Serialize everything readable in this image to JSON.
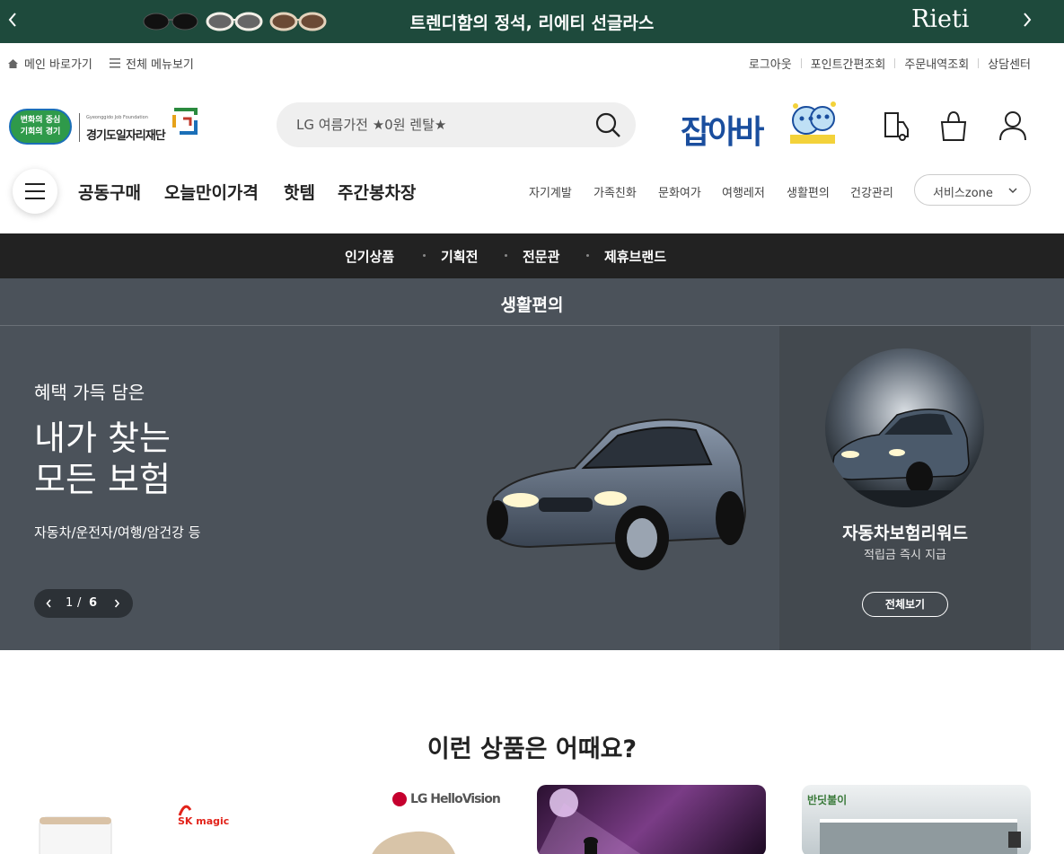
{
  "promo": {
    "title": "트렌디함의 정석, 리에티 선글라스",
    "brand": "Rieti",
    "prev_icon": "chevron-left-icon",
    "next_icon": "chevron-right-icon"
  },
  "utility": {
    "home_label": "메인 바로가기",
    "menu_label": "전체 메뉴보기",
    "links": [
      "로그아웃",
      "포인트간편조회",
      "주문내역조회",
      "상담센터"
    ]
  },
  "header": {
    "logo_badge_line1": "변화의 중심",
    "logo_badge_line2": "기회의 경기",
    "logo_en": "Gyeonggido Job Foundation",
    "logo_ko": "경기도일자리재단",
    "search_placeholder": "LG 여름가전 ★0원 렌탈★",
    "jobaba": "잡아바"
  },
  "nav": {
    "main": [
      "공동구매",
      "오늘만이가격",
      "핫템",
      "주간봉차장"
    ],
    "sub": [
      "자기계발",
      "가족친화",
      "문화여가",
      "여행레저",
      "생활편의",
      "건강관리"
    ],
    "service_zone": "서비스zone"
  },
  "categories": [
    "인기상품",
    "기획전",
    "전문관",
    "제휴브랜드"
  ],
  "section_title": "생활편의",
  "hero": {
    "eyebrow": "혜택 가득 담은",
    "headline_line1": "내가 찾는",
    "headline_line2": "모든 보험",
    "desc": "자동차/운전자/여행/암건강 등",
    "page_current": "1",
    "page_sep": "/",
    "page_total": "6"
  },
  "side": {
    "title": "자동차보험리워드",
    "subtitle": "적립금 즉시 지급",
    "button": "전체보기"
  },
  "recommend": {
    "title": "이런 상품은 어때요?",
    "cards": [
      {
        "brand": "SK magic"
      },
      {
        "brand": "LG HelloVision"
      },
      {
        "brand": ""
      },
      {
        "brand": "반딧불이"
      }
    ]
  },
  "colors": {
    "promo_bg": "#1e4a3c",
    "catbar_bg": "#222222",
    "hero_bg": "#4b525a",
    "accent_green": "#2a8a3e"
  }
}
